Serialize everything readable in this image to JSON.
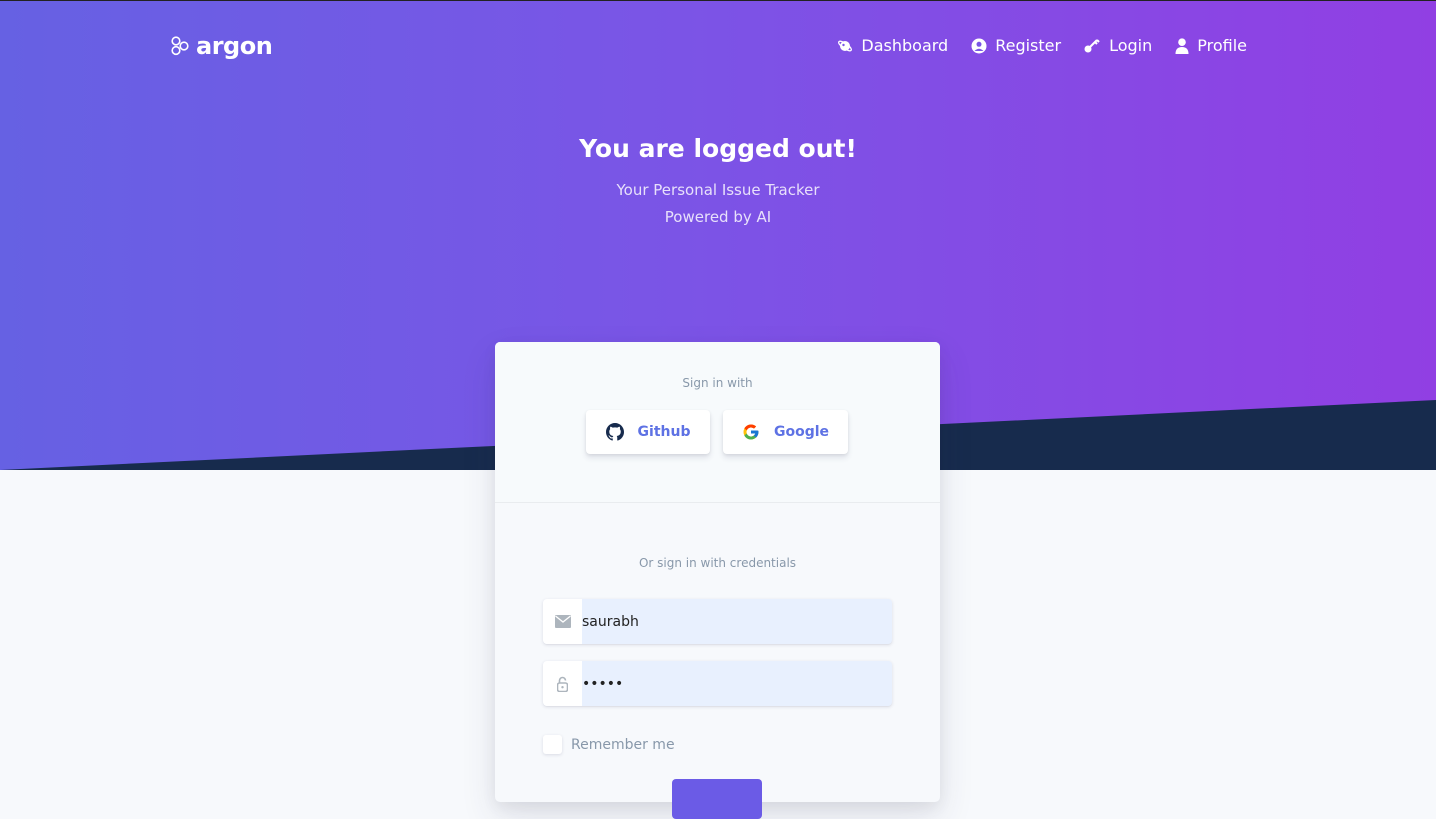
{
  "nav": {
    "brand": "argon",
    "links": [
      {
        "label": "Dashboard",
        "icon": "planet-icon"
      },
      {
        "label": "Register",
        "icon": "user-circle-icon"
      },
      {
        "label": "Login",
        "icon": "key-icon"
      },
      {
        "label": "Profile",
        "icon": "user-icon"
      }
    ]
  },
  "hero": {
    "title": "You are logged out!",
    "subtitle_line1": "Your Personal Issue Tracker",
    "subtitle_line2": "Powered by AI"
  },
  "card": {
    "sign_in_with": "Sign in with",
    "github_label": "Github",
    "google_label": "Google",
    "credentials_text": "Or sign in with credentials",
    "username_value": "saurabh",
    "password_value": "•••••",
    "remember_label": "Remember me",
    "signin_button": ""
  },
  "colors": {
    "gradient_start": "#6661e3",
    "gradient_end": "#913fe3",
    "wave": "#172b4d",
    "accent": "#5e72e4"
  }
}
